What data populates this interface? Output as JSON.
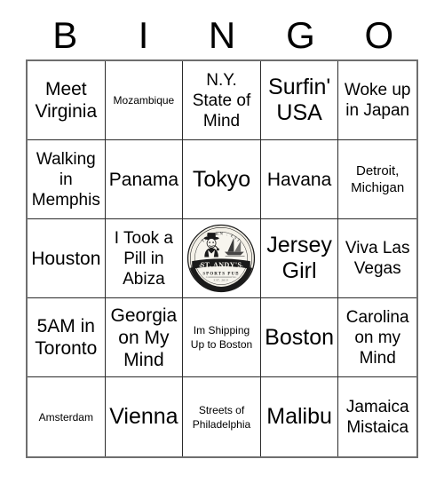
{
  "header": {
    "letters": [
      "B",
      "I",
      "N",
      "G",
      "O"
    ]
  },
  "grid": {
    "rows": [
      [
        {
          "text": "Meet Virginia",
          "size": "fs-lg"
        },
        {
          "text": "Mozambique",
          "size": "fs-xs"
        },
        {
          "text": "N.Y. State of Mind",
          "size": "fs-md"
        },
        {
          "text": "Surfin' USA",
          "size": "fs-xl"
        },
        {
          "text": "Woke up in Japan",
          "size": "fs-md"
        }
      ],
      [
        {
          "text": "Walking in Memphis",
          "size": "fs-md"
        },
        {
          "text": "Panama",
          "size": "fs-lg"
        },
        {
          "text": "Tokyo",
          "size": "fs-xl"
        },
        {
          "text": "Havana",
          "size": "fs-lg"
        },
        {
          "text": "Detroit, Michigan",
          "size": "fs-sm"
        }
      ],
      [
        {
          "text": "Houston",
          "size": "fs-lg"
        },
        {
          "text": "I Took a Pill in Abiza",
          "size": "fs-md"
        },
        {
          "text": "",
          "size": "fs-md",
          "logo": true
        },
        {
          "text": "Jersey Girl",
          "size": "fs-xl"
        },
        {
          "text": "Viva Las Vegas",
          "size": "fs-md"
        }
      ],
      [
        {
          "text": "5AM in Toronto",
          "size": "fs-lg"
        },
        {
          "text": "Georgia on My Mind",
          "size": "fs-lg"
        },
        {
          "text": "Im Shipping Up to Boston",
          "size": "fs-xs"
        },
        {
          "text": "Boston",
          "size": "fs-xl"
        },
        {
          "text": "Carolina on my Mind",
          "size": "fs-md"
        }
      ],
      [
        {
          "text": "Amsterdam",
          "size": "fs-xs"
        },
        {
          "text": "Vienna",
          "size": "fs-xl"
        },
        {
          "text": "Streets of Philadelphia",
          "size": "fs-xs"
        },
        {
          "text": "Malibu",
          "size": "fs-xl"
        },
        {
          "text": "Jamaica Mistaica",
          "size": "fs-md"
        }
      ]
    ]
  },
  "logo": {
    "name": "st-andys-sports-pub-logo",
    "top_arc_text": "TAVERN . EST",
    "banner_text": "ST. ANDY'S",
    "subtitle": "SPORTS PUB",
    "established": "EST. 2019",
    "bottom_arc_text": "WHERE THE LOCALS GO",
    "colors": {
      "ink": "#1a1a1a",
      "cream": "#f4f1e8"
    }
  }
}
